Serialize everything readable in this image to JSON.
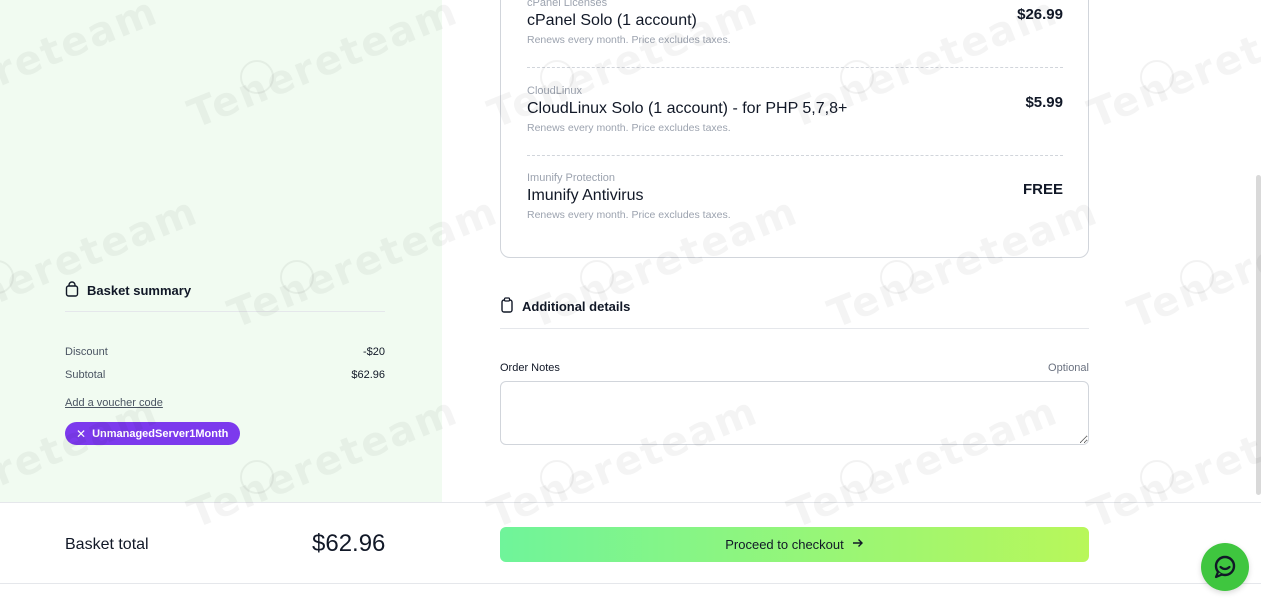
{
  "products": [
    {
      "category": "cPanel Licenses",
      "name": "cPanel Solo (1 account)",
      "renew": "Renews every month. Price excludes taxes.",
      "price": "$26.99"
    },
    {
      "category": "CloudLinux",
      "name": "CloudLinux Solo (1 account) - for PHP 5,7,8+",
      "renew": "Renews every month. Price excludes taxes.",
      "price": "$5.99"
    },
    {
      "category": "Imunify Protection",
      "name": "Imunify Antivirus",
      "renew": "Renews every month. Price excludes taxes.",
      "price": "FREE"
    }
  ],
  "additional": {
    "title": "Additional details",
    "notes_label": "Order Notes",
    "notes_optional": "Optional",
    "notes_value": ""
  },
  "basket": {
    "title": "Basket summary",
    "discount_label": "Discount",
    "discount_value": "-$20",
    "subtotal_label": "Subtotal",
    "subtotal_value": "$62.96",
    "voucher_link": "Add a voucher code",
    "coupon_code": "UnmanagedServer1Month"
  },
  "footer": {
    "total_label": "Basket total",
    "total_value": "$62.96",
    "checkout_label": "Proceed to checkout"
  },
  "watermark": "Tenereteam",
  "colors": {
    "left_panel_bg": "#f1fbf1",
    "coupon_bg": "#7c3aed",
    "checkout_gradient_start": "#6ff49a",
    "checkout_gradient_end": "#b8f75a",
    "chat_bg": "#3fc63f"
  },
  "icons": {
    "basket": "shopping-bag-icon",
    "details": "clipboard-icon",
    "remove": "close-icon",
    "checkout": "arrow-right-icon",
    "chat": "chat-bubble-icon"
  }
}
